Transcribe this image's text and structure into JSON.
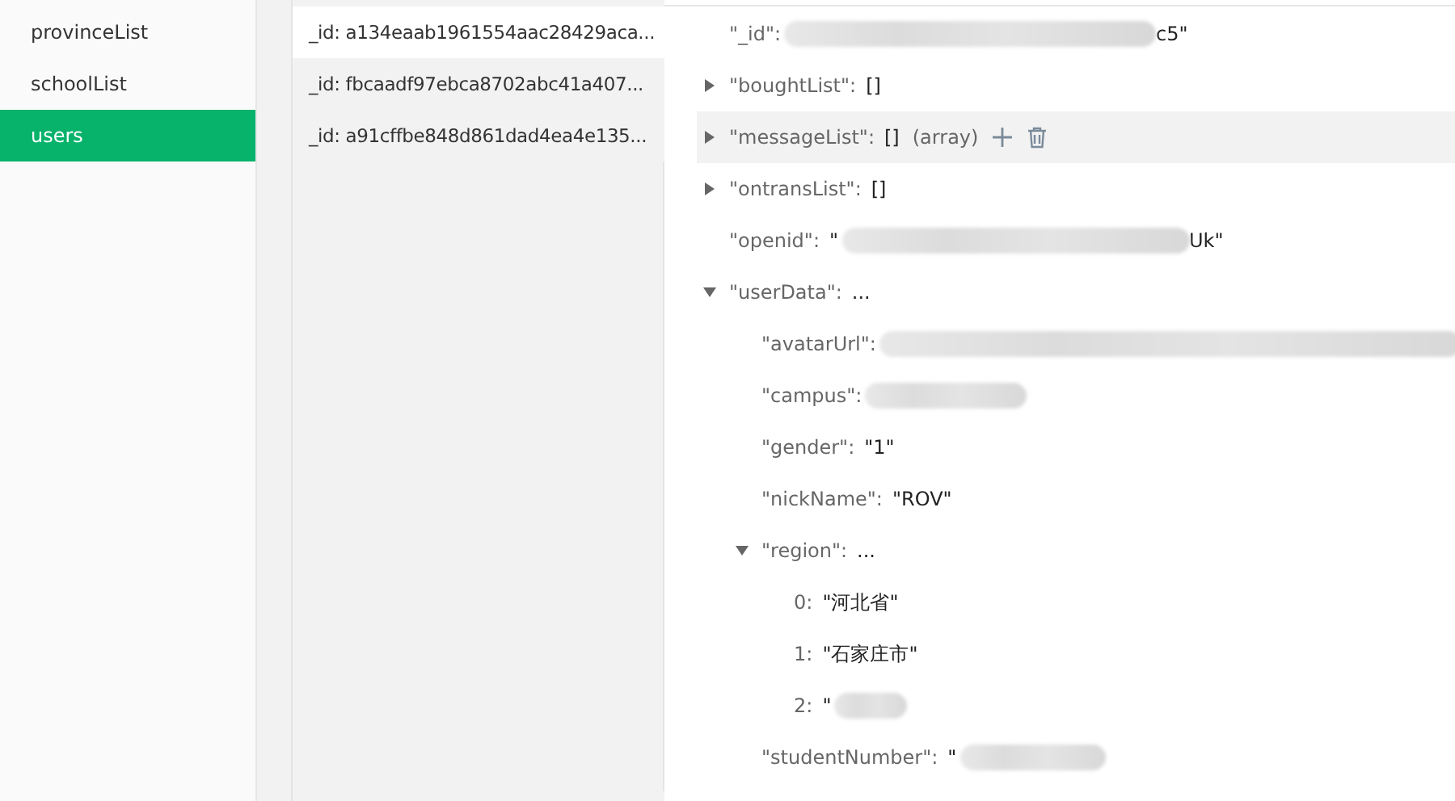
{
  "collections": [
    {
      "name": "provinceList",
      "selected": false
    },
    {
      "name": "schoolList",
      "selected": false
    },
    {
      "name": "users",
      "selected": true
    }
  ],
  "documents": [
    {
      "label": "_id: a134eaab1961554aac28429aca...",
      "selected": true
    },
    {
      "label": "_id: fbcaadf97ebca8702abc41a407...",
      "selected": false
    },
    {
      "label": "_id: a91cffbe848d861dad4ea4e135...",
      "selected": false
    }
  ],
  "fields": [
    {
      "key": "\"_id\":",
      "redacted": true,
      "after": "c5\"",
      "highlighted": false
    },
    {
      "key": "\"boughtList\":",
      "value": "[]",
      "expanded": false,
      "highlighted": false
    },
    {
      "key": "\"messageList\":",
      "value": "[]",
      "type_label": "(array)",
      "expanded": false,
      "highlighted": true
    },
    {
      "key": "\"ontransList\":",
      "value": "[]",
      "expanded": false,
      "highlighted": false
    },
    {
      "key": "\"openid\":",
      "redacted": true,
      "before": "\"",
      "after": "Uk\"",
      "highlighted": false
    },
    {
      "key": "\"userData\":",
      "value": "...",
      "expanded": true,
      "highlighted": false,
      "children": [
        {
          "key": "\"avatarUrl\":",
          "redacted": true,
          "highlighted": false
        },
        {
          "key": "\"campus\":",
          "redacted": true,
          "highlighted": false
        },
        {
          "key": "\"gender\":",
          "value": "\"1\"",
          "highlighted": false
        },
        {
          "key": "\"nickName\":",
          "value": "\"ROV\"",
          "highlighted": false
        },
        {
          "key": "\"region\":",
          "value": "...",
          "expanded": true,
          "highlighted": false,
          "children": [
            {
              "key": "0:",
              "value": "\"河北省\"",
              "highlighted": false
            },
            {
              "key": "1:",
              "value": "\"石家庄市\"",
              "highlighted": false
            },
            {
              "key": "2:",
              "redacted": true,
              "before": "\"",
              "highlighted": false
            }
          ]
        },
        {
          "key": "\"studentNumber\":",
          "redacted": true,
          "before": "\"",
          "highlighted": false
        }
      ]
    }
  ]
}
